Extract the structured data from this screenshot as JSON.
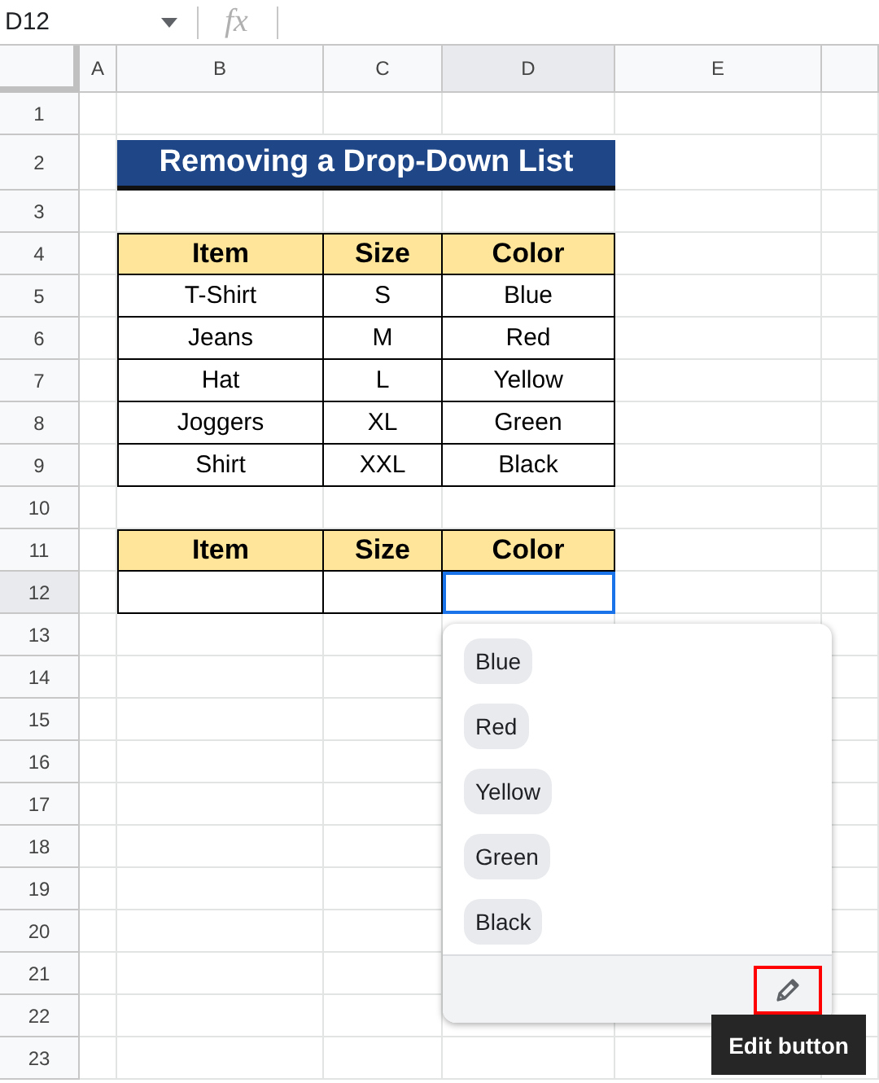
{
  "name_box": "D12",
  "formula_icon": "fx",
  "columns": [
    {
      "label": "A",
      "selected": false
    },
    {
      "label": "B",
      "selected": false
    },
    {
      "label": "C",
      "selected": false
    },
    {
      "label": "D",
      "selected": true
    },
    {
      "label": "E",
      "selected": false
    }
  ],
  "rows": [
    {
      "label": "1",
      "selected": false
    },
    {
      "label": "2",
      "selected": false
    },
    {
      "label": "3",
      "selected": false
    },
    {
      "label": "4",
      "selected": false
    },
    {
      "label": "5",
      "selected": false
    },
    {
      "label": "6",
      "selected": false
    },
    {
      "label": "7",
      "selected": false
    },
    {
      "label": "8",
      "selected": false
    },
    {
      "label": "9",
      "selected": false
    },
    {
      "label": "10",
      "selected": false
    },
    {
      "label": "11",
      "selected": false
    },
    {
      "label": "12",
      "selected": true
    },
    {
      "label": "13",
      "selected": false
    },
    {
      "label": "14",
      "selected": false
    },
    {
      "label": "15",
      "selected": false
    },
    {
      "label": "16",
      "selected": false
    },
    {
      "label": "17",
      "selected": false
    },
    {
      "label": "18",
      "selected": false
    },
    {
      "label": "19",
      "selected": false
    },
    {
      "label": "20",
      "selected": false
    },
    {
      "label": "21",
      "selected": false
    },
    {
      "label": "22",
      "selected": false
    },
    {
      "label": "23",
      "selected": false
    }
  ],
  "title": "Removing a Drop-Down List",
  "table1": {
    "columns": [
      "Item",
      "Size",
      "Color"
    ],
    "rows": [
      [
        "T-Shirt",
        "S",
        "Blue"
      ],
      [
        "Jeans",
        "M",
        "Red"
      ],
      [
        "Hat",
        "L",
        "Yellow"
      ],
      [
        "Joggers",
        "XL",
        "Green"
      ],
      [
        "Shirt",
        "XXL",
        "Black"
      ]
    ]
  },
  "table2": {
    "columns": [
      "Item",
      "Size",
      "Color"
    ],
    "input_cells": [
      {
        "selected": false
      },
      {
        "selected": false
      },
      {
        "selected": true
      }
    ]
  },
  "dropdown": {
    "options": [
      "Blue",
      "Red",
      "Yellow",
      "Green",
      "Black"
    ],
    "edit_button_highlighted": true
  },
  "tooltip": "Edit button"
}
